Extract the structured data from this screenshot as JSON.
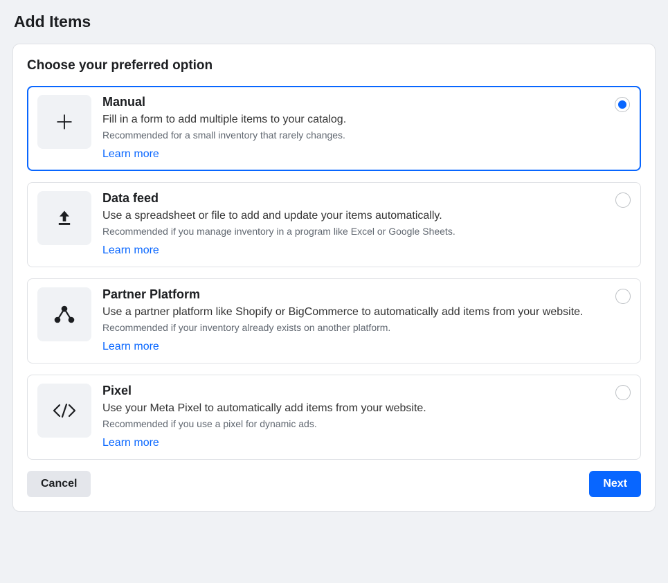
{
  "page": {
    "title": "Add Items"
  },
  "section": {
    "heading": "Choose your preferred option"
  },
  "options": {
    "manual": {
      "title": "Manual",
      "description": "Fill in a form to add multiple items to your catalog.",
      "recommendation": "Recommended for a small inventory that rarely changes.",
      "learn_more": "Learn more",
      "selected": true
    },
    "data_feed": {
      "title": "Data feed",
      "description": "Use a spreadsheet or file to add and update your items automatically.",
      "recommendation": "Recommended if you manage inventory in a program like Excel or Google Sheets.",
      "learn_more": "Learn more",
      "selected": false
    },
    "partner": {
      "title": "Partner Platform",
      "description": "Use a partner platform like Shopify or BigCommerce to automatically add items from your website.",
      "recommendation": "Recommended if your inventory already exists on another platform.",
      "learn_more": "Learn more",
      "selected": false
    },
    "pixel": {
      "title": "Pixel",
      "description": "Use your Meta Pixel to automatically add items from your website.",
      "recommendation": "Recommended if you use a pixel for dynamic ads.",
      "learn_more": "Learn more",
      "selected": false
    }
  },
  "footer": {
    "cancel": "Cancel",
    "next": "Next"
  }
}
